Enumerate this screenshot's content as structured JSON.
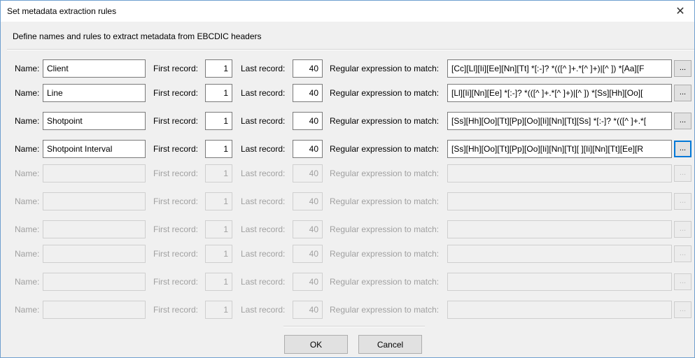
{
  "dialog": {
    "title": "Set metadata extraction rules",
    "close_glyph": "✕",
    "description": "Define names and rules to extract metadata from EBCDIC headers"
  },
  "labels": {
    "name": "Name:",
    "first_record": "First record:",
    "last_record": "Last record:",
    "regex": "Regular expression to match:",
    "browse": "..."
  },
  "rows": [
    {
      "name": "Client",
      "first": "1",
      "last": "40",
      "regex": "[Cc][Ll][Ii][Ee][Nn][Tt] *[:-]? *(([^ ]+.*[^ ]+)|[^ ]) *[Aa][F",
      "enabled": true
    },
    {
      "name": "Line",
      "first": "1",
      "last": "40",
      "regex": "[Ll][Ii][Nn][Ee] *[:-]? *(([^ ]+.*[^ ]+)|[^ ]) *[Ss][Hh][Oo][",
      "enabled": true
    },
    {
      "name": "Shotpoint",
      "first": "1",
      "last": "40",
      "regex": "[Ss][Hh][Oo][Tt][Pp][Oo][Ii][Nn][Tt][Ss] *[:-]? *(([^ ]+.*[",
      "enabled": true
    },
    {
      "name": "Shotpoint Interval",
      "first": "1",
      "last": "40",
      "regex": "[Ss][Hh][Oo][Tt][Pp][Oo][Ii][Nn][Tt][  ][Ii][Nn][Tt][Ee][R",
      "enabled": true
    },
    {
      "name": "",
      "first": "1",
      "last": "40",
      "regex": "",
      "enabled": false
    },
    {
      "name": "",
      "first": "1",
      "last": "40",
      "regex": "",
      "enabled": false
    },
    {
      "name": "",
      "first": "1",
      "last": "40",
      "regex": "",
      "enabled": false
    },
    {
      "name": "",
      "first": "1",
      "last": "40",
      "regex": "",
      "enabled": false
    },
    {
      "name": "",
      "first": "1",
      "last": "40",
      "regex": "",
      "enabled": false
    },
    {
      "name": "",
      "first": "1",
      "last": "40",
      "regex": "",
      "enabled": false
    }
  ],
  "buttons": {
    "ok": "OK",
    "cancel": "Cancel"
  }
}
